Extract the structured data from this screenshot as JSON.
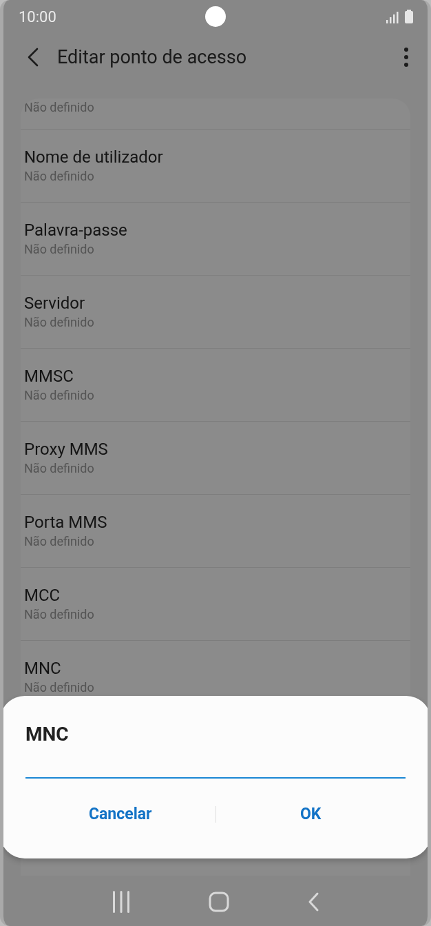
{
  "status_bar": {
    "time": "10:00"
  },
  "app_bar": {
    "title": "Editar ponto de acesso"
  },
  "settings": [
    {
      "summary": "Não definido"
    },
    {
      "title": "Nome de utilizador",
      "summary": "Não definido"
    },
    {
      "title": "Palavra-passe",
      "summary": "Não definido"
    },
    {
      "title": "Servidor",
      "summary": "Não definido"
    },
    {
      "title": "MMSC",
      "summary": "Não definido"
    },
    {
      "title": "Proxy MMS",
      "summary": "Não definido"
    },
    {
      "title": "Porta MMS",
      "summary": "Não definido"
    },
    {
      "title": "MCC",
      "summary": "Não definido"
    },
    {
      "title": "MNC",
      "summary": "Não definido"
    }
  ],
  "dialog": {
    "title": "MNC",
    "buttons": [
      "Cancelar",
      "OK"
    ]
  }
}
